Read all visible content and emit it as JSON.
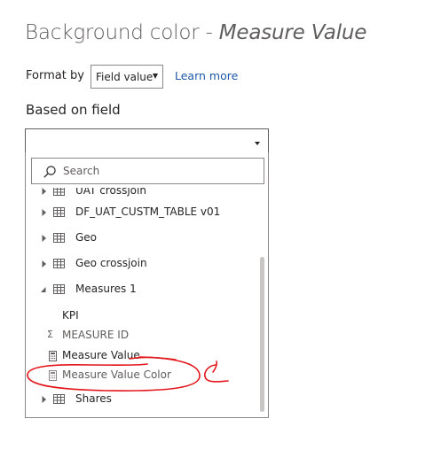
{
  "title": {
    "prefix": "Background color - ",
    "field": "Measure Value"
  },
  "format_by": {
    "label": "Format by",
    "selected": "Field value",
    "learn_more": "Learn more"
  },
  "based_on_field": {
    "label": "Based on field",
    "value": ""
  },
  "search": {
    "placeholder": "Search"
  },
  "field_list": [
    {
      "label": "UAT crossjoin",
      "kind": "table",
      "expanded": false
    },
    {
      "label": "DF_UAT_CUSTM_TABLE v01",
      "kind": "table",
      "expanded": false
    },
    {
      "label": "Geo",
      "kind": "table",
      "expanded": false
    },
    {
      "label": "Geo crossjoin",
      "kind": "table",
      "expanded": false
    },
    {
      "label": "Measures 1",
      "kind": "table",
      "expanded": true
    },
    {
      "label": "KPI",
      "kind": "folder"
    },
    {
      "label": "MEASURE ID",
      "kind": "sum-column"
    },
    {
      "label": "Measure Value",
      "kind": "measure"
    },
    {
      "label": "Measure Value Color",
      "kind": "measure",
      "disabled": true
    },
    {
      "label": "Shares",
      "kind": "table",
      "expanded": false
    }
  ],
  "colors": {
    "annotation": "#e3161b",
    "link": "#1f58a8",
    "scroll_thumb": "#c8c6c4"
  }
}
